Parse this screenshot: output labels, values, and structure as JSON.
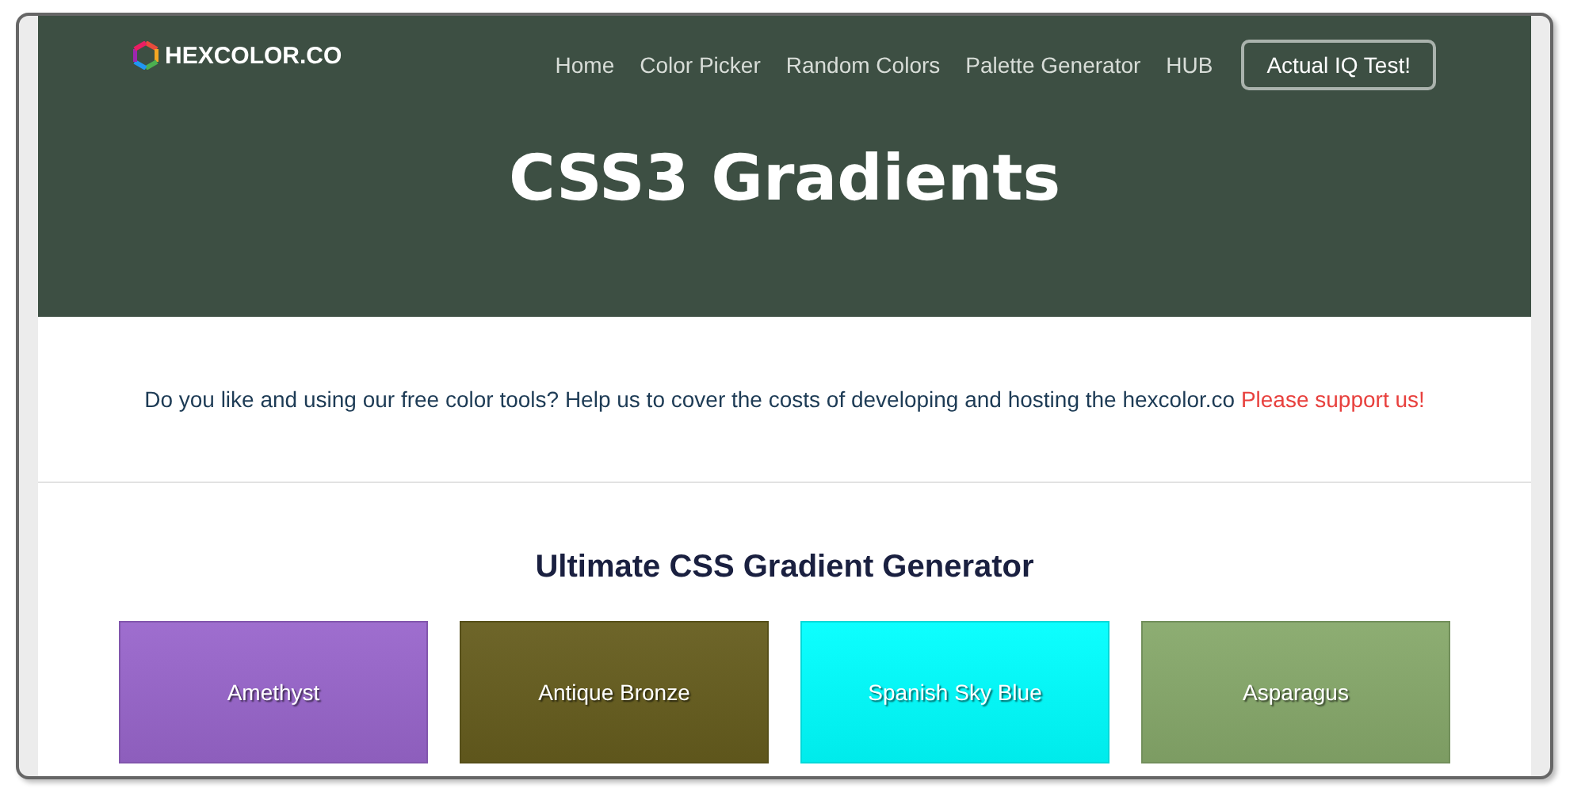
{
  "header": {
    "logo": "HEXCOLOR.CO",
    "nav": [
      {
        "label": "Home"
      },
      {
        "label": "Color Picker"
      },
      {
        "label": "Random Colors"
      },
      {
        "label": "Palette Generator"
      },
      {
        "label": "HUB"
      }
    ],
    "cta": "Actual IQ Test!",
    "title": "CSS3 Gradients"
  },
  "support": {
    "text": "Do you like and using our free color tools? Help us to cover the costs of developing and hosting the hexcolor.co",
    "link": "Please support us!"
  },
  "section": {
    "heading": "Ultimate CSS Gradient Generator",
    "gradients": [
      {
        "name": "Amethyst",
        "color": "#9966cc"
      },
      {
        "name": "Antique Bronze",
        "color": "#665d1e"
      },
      {
        "name": "Spanish Sky Blue",
        "color": "#00ffff"
      },
      {
        "name": "Asparagus",
        "color": "#87a96b"
      }
    ]
  }
}
